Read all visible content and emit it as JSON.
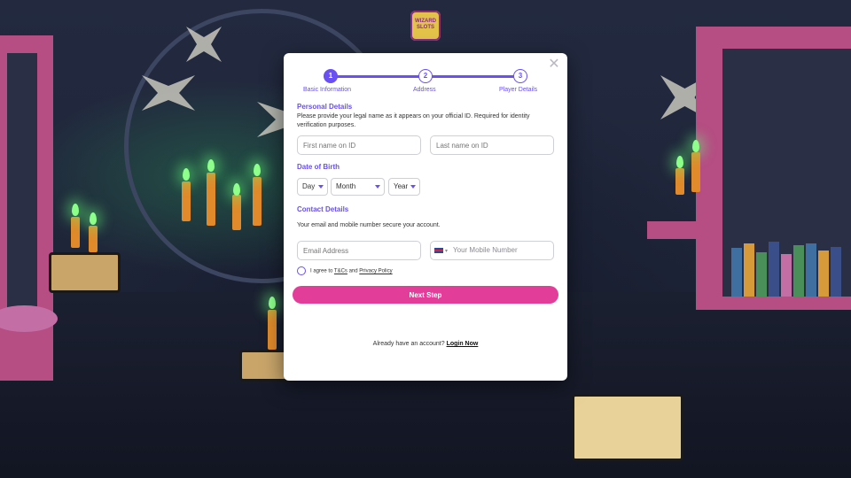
{
  "brand": {
    "logo_text": "WIZARD SLOTS"
  },
  "stepper": {
    "steps": [
      {
        "number": "1",
        "label": "Basic Information",
        "state": "active"
      },
      {
        "number": "2",
        "label": "Address",
        "state": "upcoming"
      },
      {
        "number": "3",
        "label": "Player Details",
        "state": "upcoming"
      }
    ]
  },
  "personal": {
    "title": "Personal Details",
    "description": "Please provide your legal name as it appears on your official ID. Required for identity verification purposes.",
    "first_name_placeholder": "First name on ID",
    "last_name_placeholder": "Last name on ID"
  },
  "dob": {
    "title": "Date of Birth",
    "day": "Day",
    "month": "Month",
    "year": "Year"
  },
  "contact": {
    "title": "Contact Details",
    "description": "Your email and mobile number secure your account.",
    "email_placeholder": "Email Address",
    "mobile_placeholder": "Your Mobile Number",
    "country_flag": "uk-flag-icon"
  },
  "agreement": {
    "prefix": "I agree to",
    "tcs_link": "T&Cs",
    "and": "and",
    "privacy_link": "Privacy Policy"
  },
  "cta": {
    "label": "Next Step"
  },
  "footer": {
    "prompt": "Already have an account?",
    "login_link": "Login Now"
  },
  "colors": {
    "accent": "#6a4ff2",
    "cta": "#e33d9a"
  }
}
